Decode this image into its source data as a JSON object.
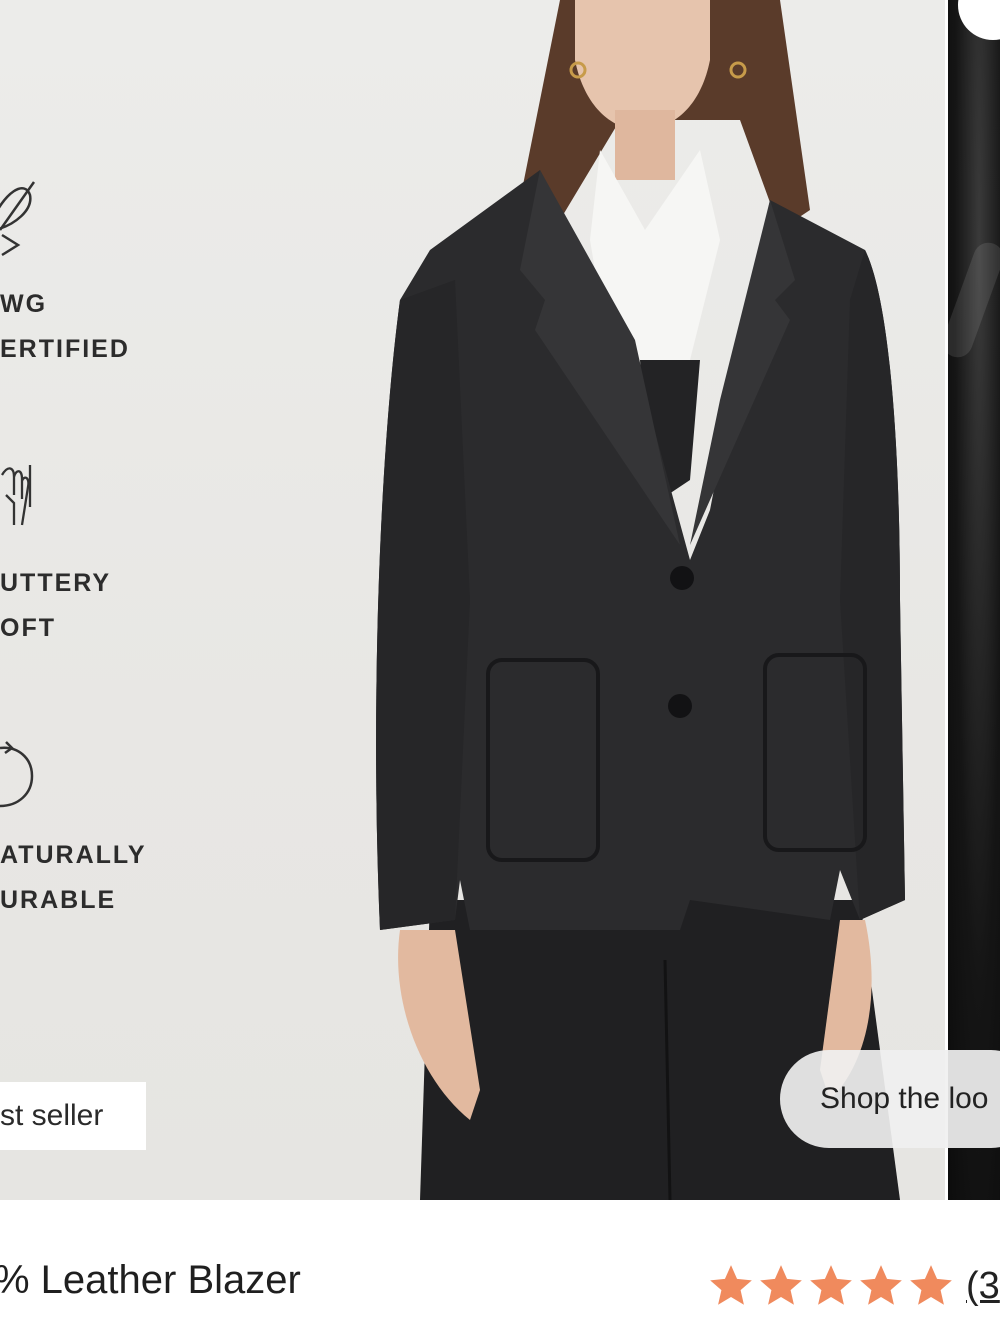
{
  "features": [
    {
      "icon": "leaf-certified-icon",
      "line1": "WG",
      "line2": "ERTIFIED"
    },
    {
      "icon": "soft-touch-hand-icon",
      "line1": "UTTERY",
      "line2": "OFT"
    },
    {
      "icon": "durability-cycle-icon",
      "line1": "ATURALLY",
      "line2": "URABLE"
    }
  ],
  "hero": {
    "badge_label": "st seller",
    "shop_the_look_label": "Shop the loo"
  },
  "product": {
    "title": "% Leather Blazer",
    "rating_stars": 5,
    "review_count_label": "(3"
  },
  "colors": {
    "star": "#f08a5d",
    "jacket": "#2b2b2d",
    "background": "#e9e8e5"
  }
}
